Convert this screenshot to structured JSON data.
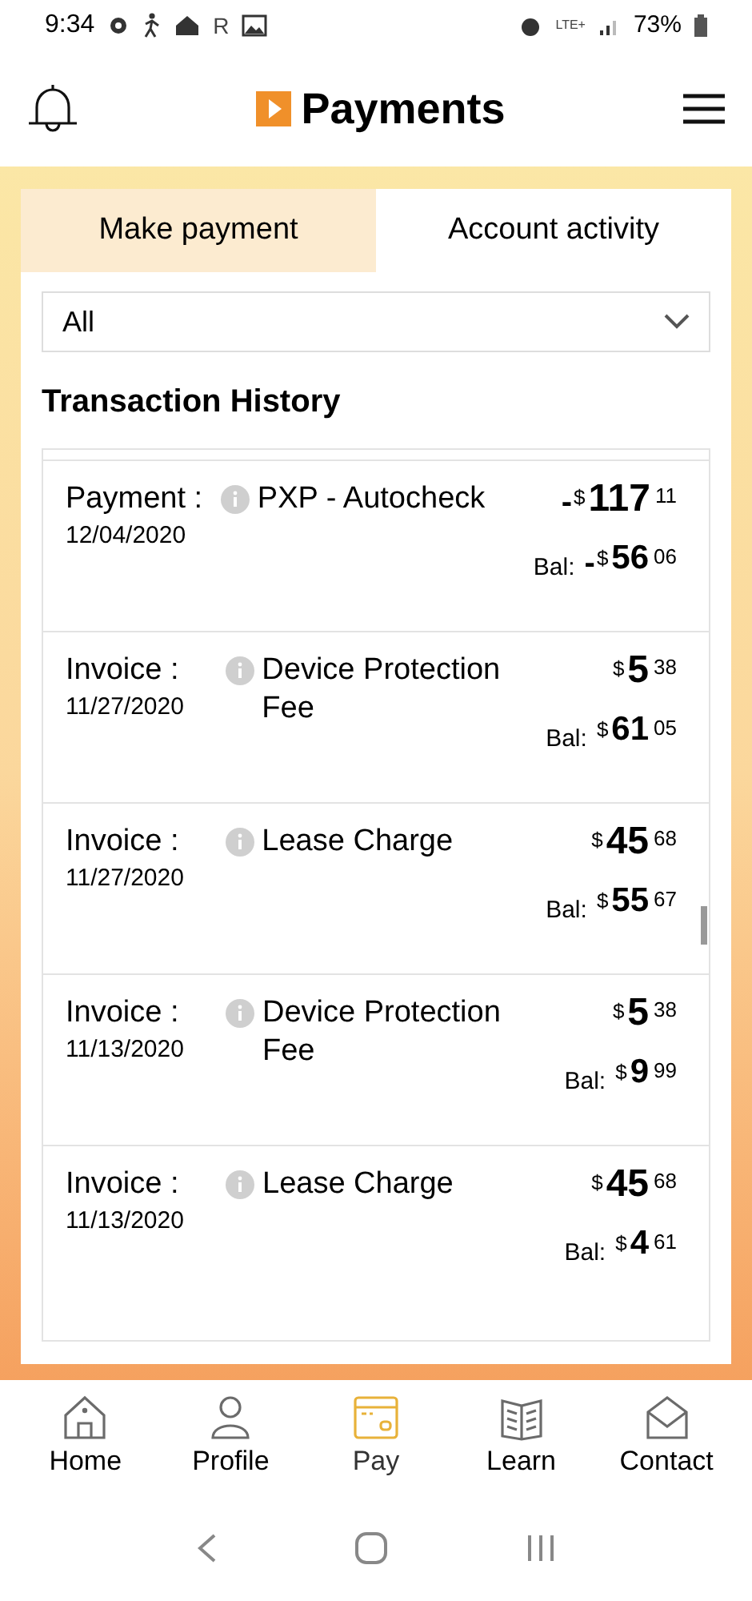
{
  "status_bar": {
    "time": "9:34",
    "roaming": "R",
    "network": "LTE+",
    "battery": "73%"
  },
  "header": {
    "title": "Payments"
  },
  "tabs": [
    {
      "label": "Make payment",
      "selected": false
    },
    {
      "label": "Account activity",
      "selected": true
    }
  ],
  "filter": {
    "value": "All"
  },
  "section_title": "Transaction History",
  "transactions": [
    {
      "type": "Payment :",
      "date": "12/04/2020",
      "description": "PXP - Autocheck",
      "amount": {
        "sign": "-",
        "currency": "$",
        "whole": "117",
        "cents": "11"
      },
      "balance_label": "Bal:",
      "balance": {
        "sign": "-",
        "currency": "$",
        "whole": "56",
        "cents": "06"
      }
    },
    {
      "type": "Invoice :",
      "date": "11/27/2020",
      "description": "Device Protection Fee",
      "amount": {
        "currency": "$",
        "whole": "5",
        "cents": "38"
      },
      "balance_label": "Bal:",
      "balance": {
        "currency": "$",
        "whole": "61",
        "cents": "05"
      }
    },
    {
      "type": "Invoice :",
      "date": "11/27/2020",
      "description": "Lease Charge",
      "amount": {
        "currency": "$",
        "whole": "45",
        "cents": "68"
      },
      "balance_label": "Bal:",
      "balance": {
        "currency": "$",
        "whole": "55",
        "cents": "67"
      }
    },
    {
      "type": "Invoice :",
      "date": "11/13/2020",
      "description": "Device Protection Fee",
      "amount": {
        "currency": "$",
        "whole": "5",
        "cents": "38"
      },
      "balance_label": "Bal:",
      "balance": {
        "currency": "$",
        "whole": "9",
        "cents": "99"
      }
    },
    {
      "type": "Invoice :",
      "date": "11/13/2020",
      "description": "Lease Charge",
      "amount": {
        "currency": "$",
        "whole": "45",
        "cents": "68"
      },
      "balance_label": "Bal:",
      "balance": {
        "currency": "$",
        "whole": "4",
        "cents": "61"
      }
    }
  ],
  "bottom_nav": [
    {
      "kind": "home",
      "label": "Home",
      "selected": false
    },
    {
      "kind": "profile",
      "label": "Profile",
      "selected": false
    },
    {
      "kind": "pay",
      "label": "Pay",
      "selected": true
    },
    {
      "kind": "learn",
      "label": "Learn",
      "selected": false
    },
    {
      "kind": "contact",
      "label": "Contact",
      "selected": false
    }
  ]
}
